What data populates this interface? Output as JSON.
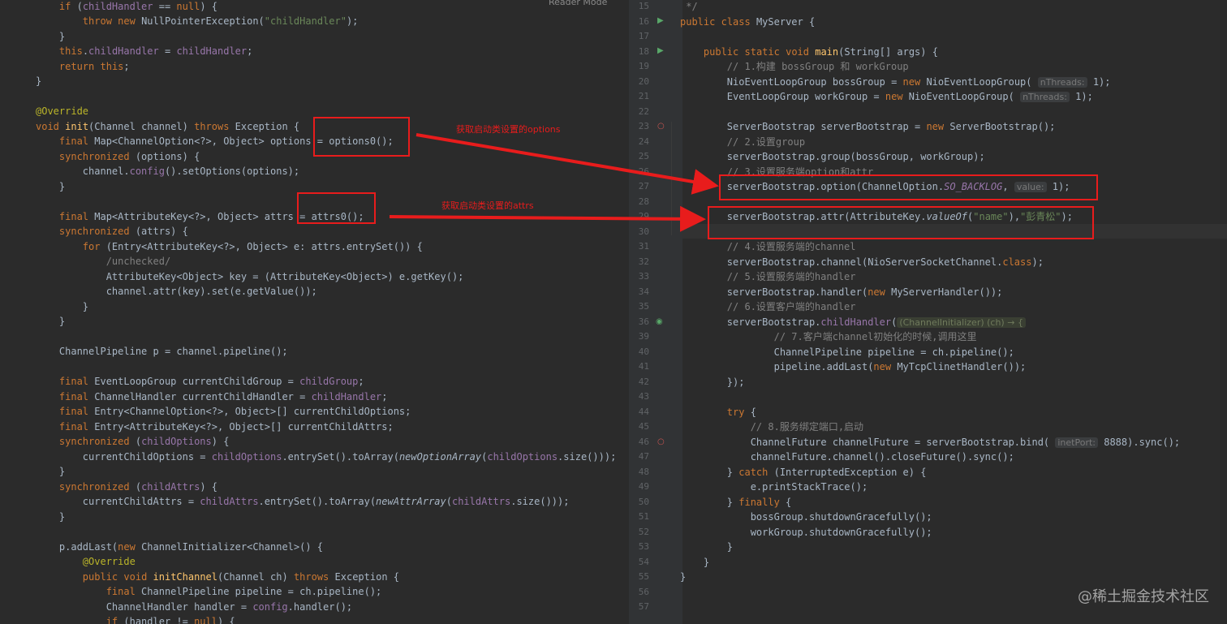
{
  "left_code": [
    "    if (childHandler == null) {",
    "        throw new NullPointerException(\"childHandler\");",
    "    }",
    "    this.childHandler = childHandler;",
    "    return this;",
    "}",
    "",
    "@Override",
    "void init(Channel channel) throws Exception {",
    "    final Map<ChannelOption<?>, Object> options = options0();",
    "    synchronized (options) {",
    "        channel.config().setOptions(options);",
    "    }",
    "",
    "    final Map<AttributeKey<?>, Object> attrs = attrs0();",
    "    synchronized (attrs) {",
    "        for (Entry<AttributeKey<?>, Object> e: attrs.entrySet()) {",
    "            /unchecked/",
    "            AttributeKey<Object> key = (AttributeKey<Object>) e.getKey();",
    "            channel.attr(key).set(e.getValue());",
    "        }",
    "    }",
    "",
    "    ChannelPipeline p = channel.pipeline();",
    "",
    "    final EventLoopGroup currentChildGroup = childGroup;",
    "    final ChannelHandler currentChildHandler = childHandler;",
    "    final Entry<ChannelOption<?>, Object>[] currentChildOptions;",
    "    final Entry<AttributeKey<?>, Object>[] currentChildAttrs;",
    "    synchronized (childOptions) {",
    "        currentChildOptions = childOptions.entrySet().toArray(newOptionArray(childOptions.size()));",
    "    }",
    "    synchronized (childAttrs) {",
    "        currentChildAttrs = childAttrs.entrySet().toArray(newAttrArray(childAttrs.size()));",
    "    }",
    "",
    "    p.addLast(new ChannelInitializer<Channel>() {",
    "        @Override",
    "        public void initChannel(Channel ch) throws Exception {",
    "            final ChannelPipeline pipeline = ch.pipeline();",
    "            ChannelHandler handler = config.handler();",
    "            if (handler != null) {"
  ],
  "right_line_numbers": [
    "15",
    "16",
    "17",
    "18",
    "19",
    "20",
    "21",
    "22",
    "23",
    "24",
    "25",
    "26",
    "27",
    "28",
    "29",
    "30",
    "31",
    "32",
    "33",
    "34",
    "35",
    "36",
    "39",
    "40",
    "41",
    "42",
    "43",
    "44",
    "45",
    "46",
    "47",
    "48",
    "49",
    "50",
    "51",
    "52",
    "53",
    "54",
    "55",
    "56",
    "57"
  ],
  "right_code": [
    " */",
    "public class MyServer {",
    "",
    "    public static void main(String[] args) {",
    "        // 1.构建 bossGroup 和 workGroup",
    "        NioEventLoopGroup bossGroup = new NioEventLoopGroup(",
    "        EventLoopGroup workGroup = new NioEventLoopGroup(",
    "",
    "        ServerBootstrap serverBootstrap = new ServerBootstrap();",
    "        // 2.设置group",
    "        serverBootstrap.group(bossGroup, workGroup);",
    "        // 3.设置服务端option和attr",
    "        serverBootstrap.option(ChannelOption.SO_BACKLOG,",
    "",
    "        serverBootstrap.attr(AttributeKey.valueOf(\"name\"),\"彭青松\");",
    "",
    "        // 4.设置服务端的channel",
    "        serverBootstrap.channel(NioServerSocketChannel.class);",
    "        // 5.设置服务端的handler",
    "        serverBootstrap.handler(new MyServerHandler());",
    "        // 6.设置客户端的handler",
    "        serverBootstrap.childHandler(",
    "                // 7.客户端channel初始化的时候,调用这里",
    "                ChannelPipeline pipeline = ch.pipeline();",
    "                pipeline.addLast(new MyTcpClinetHandler());",
    "        });",
    "",
    "        try {",
    "            // 8.服务绑定端口,启动",
    "            ChannelFuture channelFuture = serverBootstrap.bind(",
    "            channelFuture.channel().closeFuture().sync();",
    "        } catch (InterruptedException e) {",
    "            e.printStackTrace();",
    "        } finally {",
    "            bossGroup.shutdownGracefully();",
    "            workGroup.shutdownGracefully();",
    "        }",
    "    }",
    "}",
    ""
  ],
  "hints": {
    "boss_threads": "nThreads:",
    "boss_threads_val": "1);",
    "work_threads": "nThreads:",
    "work_threads_val": "1);",
    "backlog": "value:",
    "backlog_val": "1);",
    "lambda": "(ChannelInitializer) (ch) → {",
    "port": "inetPort:",
    "port_val": "8888).sync();"
  },
  "annotations": {
    "options_label": "获取启动类设置的options",
    "attrs_label": "获取启动类设置的attrs",
    "red_color": "#e81c1c"
  },
  "reader_mode": "Reader Mode",
  "watermark": "@稀土掘金技术社区"
}
